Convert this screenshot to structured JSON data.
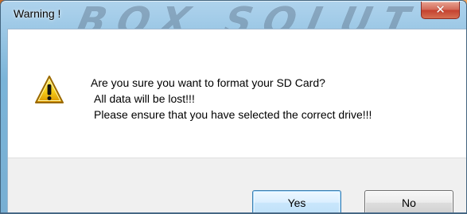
{
  "dialog": {
    "title": "Warning !",
    "background_watermark": "BOX SOLUT",
    "message": {
      "question": "Are you sure you want to format your SD Card?",
      "detail_1": "All data will be lost!!!",
      "detail_2": "Please ensure that you have selected the correct drive!!!"
    },
    "buttons": {
      "yes": "Yes",
      "no": "No"
    },
    "icons": {
      "warning": "warning-triangle-icon",
      "close": "close-icon"
    },
    "colors": {
      "title_bar": "#7ab4d8",
      "close_button": "#c5412f",
      "client_background": "#ffffff",
      "footer_background": "#f0f0f0",
      "default_button_border": "#3c7fb1",
      "warning_yellow": "#f7cf1a"
    }
  },
  "window_controls": {
    "close_symbol": "✕"
  }
}
